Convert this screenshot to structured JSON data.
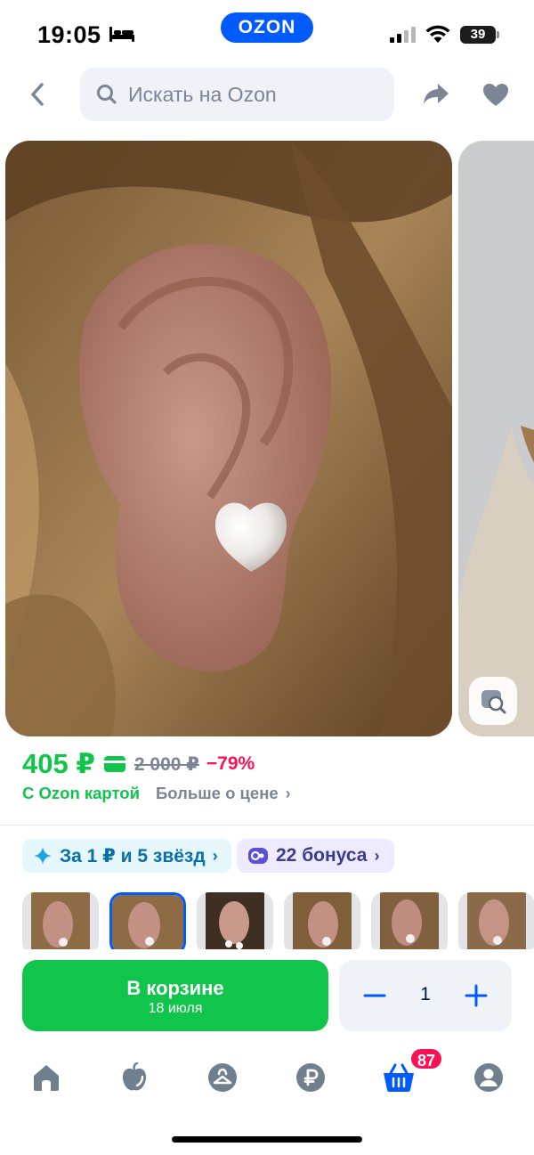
{
  "status_bar": {
    "time": "19:05",
    "brand_logo": "OZON",
    "battery": "39"
  },
  "header": {
    "search_placeholder": "Искать на Ozon",
    "icons": [
      "back-chevron-icon",
      "search-icon",
      "share-icon",
      "heart-icon"
    ]
  },
  "gallery": {
    "main_photo": "pearl heart stud earring on ear",
    "next_photo": "woman in beige blazer",
    "visual_search_icon": "image-search-icon"
  },
  "price": {
    "current": "405 ₽",
    "old": "2 000 ₽",
    "discount": "−79%",
    "card_label": "С Ozon картой",
    "more_label": "Больше о цене",
    "accent_color": "#10c44c",
    "discount_color": "#f91155"
  },
  "promos": {
    "stars_label": "За 1 ₽ и 5 звёзд",
    "bonus_label": "22 бонуса"
  },
  "thumbnails": {
    "count": 6,
    "active_index": 1
  },
  "actions": {
    "cart_label": "В корзине",
    "delivery_date": "18 июля",
    "quantity": "1"
  },
  "bottom_nav": {
    "items": [
      "home-icon",
      "fresh-icon",
      "favorites-icon",
      "finance-icon",
      "cart-icon",
      "profile-icon"
    ],
    "cart_badge": "87",
    "active_color": "#005bff",
    "inactive_color": "#707f8d"
  }
}
